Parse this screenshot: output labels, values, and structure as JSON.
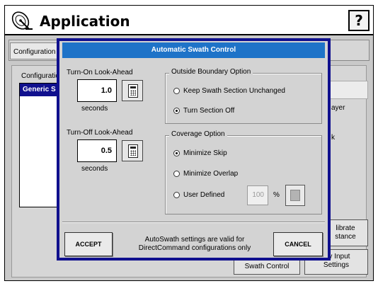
{
  "app": {
    "title": "Application",
    "help_label": "?"
  },
  "background": {
    "tab_label": "Configuration",
    "config_label": "Configuratio",
    "list_selected": "Generic S",
    "right_texts": [
      "ayer",
      "k"
    ],
    "buttons": [
      {
        "label": "librate\nstance"
      },
      {
        "label": "Swath Control"
      },
      {
        "label": "ary Input\nSettings"
      }
    ]
  },
  "dialog": {
    "title": "Automatic Swath Control",
    "turn_on": {
      "label": "Turn-On Look-Ahead",
      "value": "1.0",
      "unit": "seconds"
    },
    "turn_off": {
      "label": "Turn-Off Look-Ahead",
      "value": "0.5",
      "unit": "seconds"
    },
    "outside_boundary": {
      "title": "Outside Boundary Option",
      "options": [
        {
          "label": "Keep Swath Section Unchanged",
          "selected": false
        },
        {
          "label": "Turn Section Off",
          "selected": true
        }
      ]
    },
    "coverage": {
      "title": "Coverage Option",
      "options": [
        {
          "label": "Minimize Skip",
          "selected": true
        },
        {
          "label": "Minimize Overlap",
          "selected": false
        },
        {
          "label": "User Defined",
          "selected": false
        }
      ],
      "user_value": "100",
      "user_unit": "%"
    },
    "accept_label": "ACCEPT",
    "cancel_label": "CANCEL",
    "footnote": "AutoSwath settings are valid for DirectCommand configurations only"
  },
  "icons": {
    "app": "satellite-dish-icon",
    "calculator": "calculator-icon"
  }
}
